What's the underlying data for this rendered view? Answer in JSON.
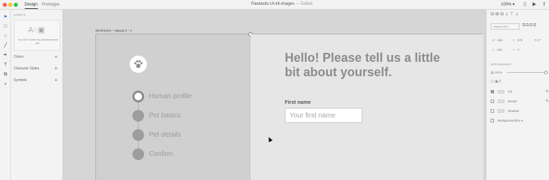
{
  "titlebar": {
    "tabs": [
      "Design",
      "Prototype"
    ],
    "doc_name": "Pawtastic-UI-kit-images",
    "doc_separator": "—",
    "doc_status": "Edited",
    "zoom": "100%",
    "icons": [
      "mobile-preview-icon",
      "play-icon",
      "share-icon"
    ]
  },
  "toolbar": {
    "tools": [
      "select-tool-icon",
      "rectangle-tool-icon",
      "ellipse-tool-icon",
      "line-tool-icon",
      "pen-tool-icon",
      "text-tool-icon",
      "artboard-tool-icon",
      "zoom-tool-icon"
    ]
  },
  "assets": {
    "header": "ASSETS",
    "empty_message": "You don't have any assets saved yet.",
    "sections": [
      "Colors",
      "Character Styles",
      "Symbols"
    ]
  },
  "canvas": {
    "artboard_label": "Wireframes – Signup 3 – 1",
    "steps": [
      {
        "label": "Human profile",
        "current": true
      },
      {
        "label": "Pet basics",
        "current": false
      },
      {
        "label": "Pet details",
        "current": false
      },
      {
        "label": "Confirm",
        "current": false
      }
    ],
    "heading": "Hello! Please tell us a little bit about yourself.",
    "first_name_label": "First name",
    "first_name_placeholder": "Your first name"
  },
  "inspector": {
    "repeat_grid": "Repeat Grid",
    "w_label": "W",
    "w_value": "864",
    "x_label": "X",
    "x_value": "576",
    "h_label": "H",
    "h_value": "900",
    "y_label": "Y",
    "y_value": "0",
    "rotation": "0°",
    "appearance_header": "APPEARANCE",
    "opacity": "100%",
    "corner_radius": "0",
    "styles": [
      {
        "label": "Fill",
        "checked": true
      },
      {
        "label": "Border",
        "checked": false
      },
      {
        "label": "Shadow",
        "checked": false
      },
      {
        "label": "Background Blur",
        "checked": false
      }
    ]
  }
}
